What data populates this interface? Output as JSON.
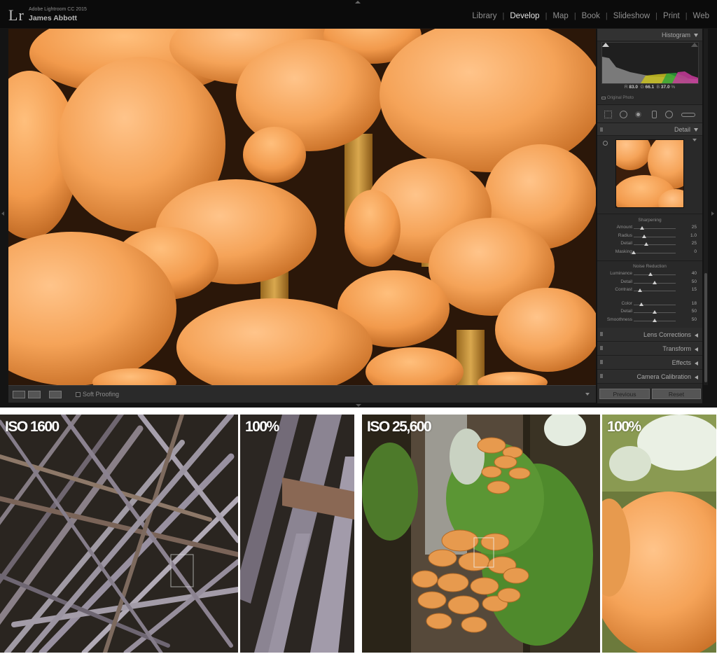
{
  "app": {
    "name": "Adobe Lightroom CC 2015",
    "logo": "Lr",
    "user": "James Abbott"
  },
  "modules": [
    "Library",
    "Develop",
    "Map",
    "Book",
    "Slideshow",
    "Print",
    "Web"
  ],
  "active_module": "Develop",
  "panel": {
    "histogram_label": "Histogram",
    "rgb": {
      "r_label": "R",
      "r": "83.0",
      "g_label": "G",
      "g": "66.1",
      "b_label": "B",
      "b": "37.0",
      "unit": "%"
    },
    "original_photo": "Original Photo",
    "detail_label": "Detail",
    "sharpening": {
      "title": "Sharpening",
      "rows": [
        {
          "label": "Amount",
          "value": "25",
          "pos": 0.2
        },
        {
          "label": "Radius",
          "value": "1.0",
          "pos": 0.25
        },
        {
          "label": "Detail",
          "value": "25",
          "pos": 0.3
        },
        {
          "label": "Masking",
          "value": "0",
          "pos": 0.0
        }
      ]
    },
    "noise_reduction": {
      "title": "Noise Reduction",
      "rows": [
        {
          "label": "Luminance",
          "value": "40",
          "pos": 0.4
        },
        {
          "label": "Detail",
          "value": "50",
          "pos": 0.5
        },
        {
          "label": "Contrast",
          "value": "15",
          "pos": 0.15
        },
        {
          "label": "Color",
          "value": "18",
          "pos": 0.18
        },
        {
          "label": "Detail",
          "value": "50",
          "pos": 0.5
        },
        {
          "label": "Smoothness",
          "value": "50",
          "pos": 0.5
        }
      ]
    },
    "collapsed": [
      "Lens Corrections",
      "Transform",
      "Effects",
      "Camera Calibration"
    ],
    "previous_label": "Previous",
    "reset_label": "Reset"
  },
  "toolbar": {
    "soft_proofing": "Soft Proofing"
  },
  "photos": [
    {
      "label": "ISO 1600"
    },
    {
      "label": "100%"
    },
    {
      "label": "ISO 25,600"
    },
    {
      "label": "100%"
    }
  ],
  "colors": {
    "bg": "#141414",
    "panel": "#292929",
    "mushroom": "#f0a35a",
    "active_text": "#e4e4e4"
  }
}
